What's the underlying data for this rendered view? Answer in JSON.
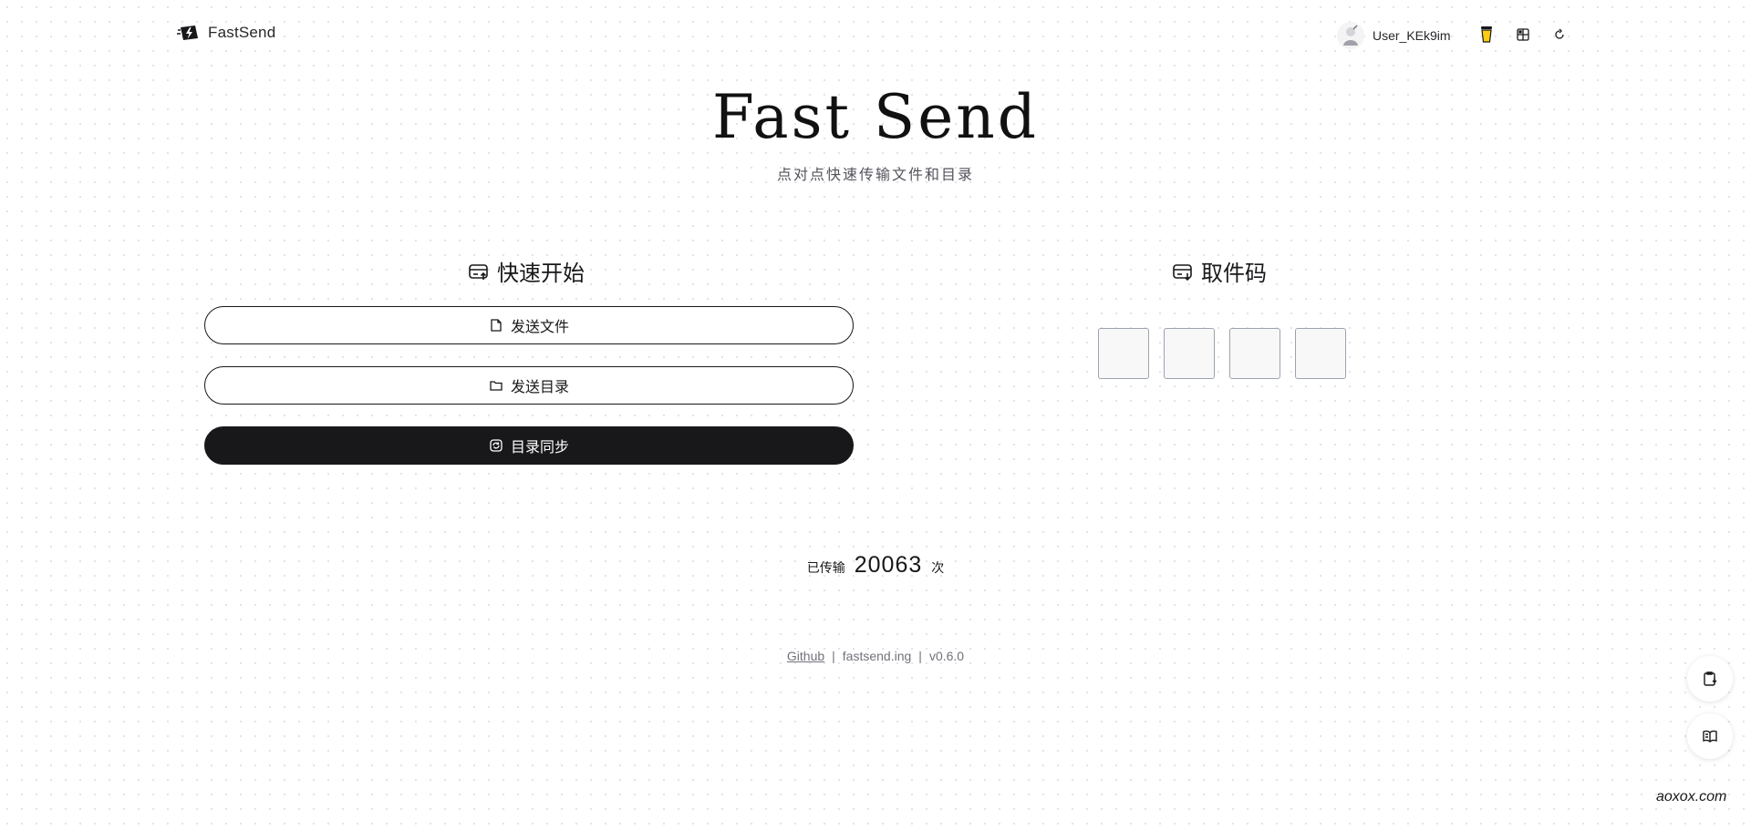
{
  "header": {
    "brand": "FastSend",
    "username": "User_KEk9im"
  },
  "hero": {
    "title": "Fast Send",
    "subtitle": "点对点快速传输文件和目录"
  },
  "quick_start": {
    "title": "快速开始",
    "send_file_label": "发送文件",
    "send_dir_label": "发送目录",
    "sync_dir_label": "目录同步"
  },
  "pickup": {
    "title": "取件码",
    "code_digits": [
      "",
      "",
      "",
      ""
    ]
  },
  "stats": {
    "prefix": "已传输",
    "count": "20063",
    "suffix": "次"
  },
  "footer": {
    "github": "Github",
    "site": "fastsend.ing",
    "version": "v0.6.0",
    "separator": "|"
  },
  "watermark": "aoxox.com",
  "colors": {
    "accent": "#18181b",
    "cup": "#facc15",
    "muted": "#71717a"
  },
  "icons": {
    "brand": "lightning-logo-icon",
    "cup": "coffee-cup-icon",
    "grid": "qr-grid-icon",
    "refresh": "refresh-icon",
    "quick_start": "send-box-icon",
    "pickup": "receive-box-icon",
    "file": "file-icon",
    "folder": "folder-icon",
    "sync": "sync-icon",
    "clipboard": "clipboard-icon",
    "book": "book-icon"
  }
}
